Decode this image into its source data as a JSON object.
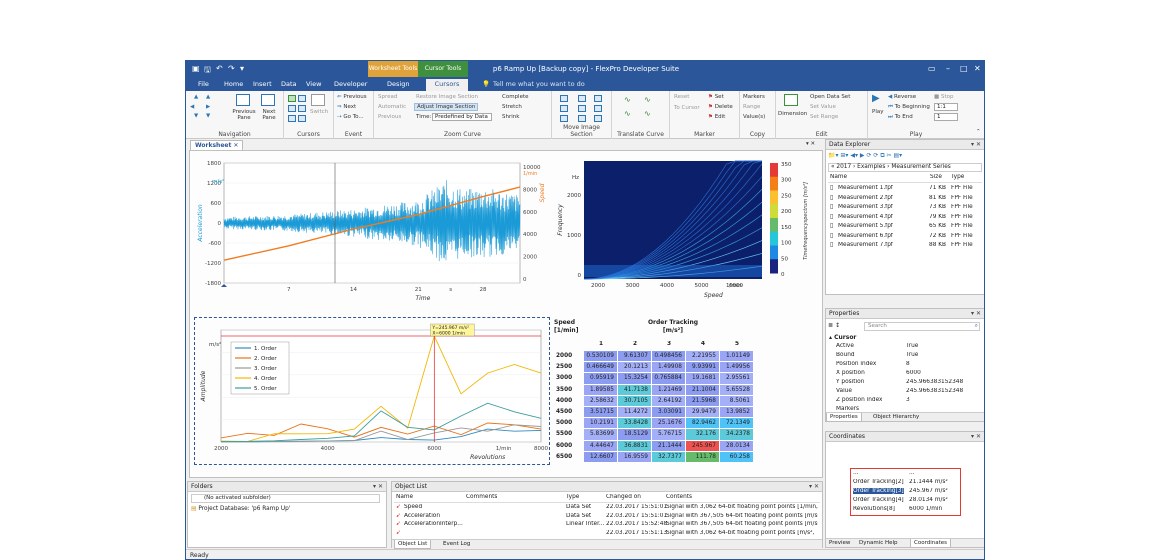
{
  "title": "p6 Ramp Up [Backup copy] - FlexPro Developer Suite",
  "context_tabs": {
    "worksheet_tools": "Worksheet Tools",
    "cursor_tools": "Cursor Tools"
  },
  "menu": [
    {
      "label": "File",
      "active": false
    },
    {
      "label": "Home",
      "active": false
    },
    {
      "label": "Insert",
      "active": false
    },
    {
      "label": "Data",
      "active": false
    },
    {
      "label": "View",
      "active": false
    },
    {
      "label": "Developer",
      "active": false
    },
    {
      "label": "Design",
      "active": false
    },
    {
      "label": "Cursors",
      "active": true
    }
  ],
  "tell_me": "Tell me what you want to do",
  "ribbon": {
    "navigation": {
      "label": "Navigation",
      "prev_pane": "Previous Pane",
      "next_pane": "Next Pane"
    },
    "cursors": {
      "label": "Cursors",
      "switch": "Switch"
    },
    "event": {
      "label": "Event",
      "previous": "Previous",
      "next": "Next",
      "goto": "Go To..."
    },
    "zoom": {
      "label": "Zoom Curve",
      "spread": "Spread",
      "automatic": "Automatic",
      "previous": "Previous",
      "restore": "Restore Image Section",
      "adjust": "Adjust Image Section",
      "time_label": "Time:",
      "time_value": "Predefined by Data",
      "complete": "Complete",
      "stretch": "Stretch",
      "shrink": "Shrink"
    },
    "move": {
      "label": "Move Image Section"
    },
    "translate": {
      "label": "Translate Curve"
    },
    "marker": {
      "label": "Marker",
      "reset": "Reset",
      "to_cursor": "To Cursor",
      "set": "Set",
      "delete": "Delete",
      "edit": "Edit"
    },
    "copy": {
      "label": "Copy",
      "markers": "Markers",
      "range": "Range",
      "values": "Value(s)"
    },
    "edit": {
      "label": "Edit",
      "dimension": "Dimension",
      "open_data_set": "Open Data Set",
      "set_value": "Set Value",
      "set_range": "Set Range"
    },
    "play": {
      "label": "Play",
      "play": "Play",
      "reverse": "Reverse",
      "to_beginning": "To Beginning",
      "to_end": "To End",
      "stop": "Stop",
      "ratio": "1:1",
      "step": "1"
    }
  },
  "doc_tab": "Worksheet",
  "chart_data": [
    {
      "type": "line",
      "x_ticks": [
        "7",
        "14",
        "21",
        "28"
      ],
      "xlabel": "Time",
      "x_unit": "s",
      "y_left_label": "Acceleration",
      "y_left_unit": "m/s²",
      "y_left_ticks": [
        "1800",
        "1200",
        "600",
        "0",
        "-600",
        "-1200",
        "-1800"
      ],
      "y_right_label": "Speed",
      "y_right_unit": "1/min",
      "y_right_ticks": [
        "10000",
        "8000",
        "6000",
        "4000",
        "2000",
        "0"
      ],
      "series": [
        {
          "name": "Acceleration",
          "color": "#1a9ad6",
          "envelope_x": [
            0,
            7,
            14,
            21,
            24,
            26,
            28,
            32
          ],
          "envelope_y": [
            180,
            250,
            420,
            700,
            1300,
            1000,
            1100,
            850
          ]
        },
        {
          "name": "Speed",
          "color": "#f07c22",
          "x": [
            0,
            7,
            14,
            21,
            28,
            32
          ],
          "y": [
            1900,
            3100,
            4500,
            5700,
            7200,
            8000
          ]
        }
      ],
      "cursor_x": 12
    },
    {
      "type": "heatmap",
      "x_ticks": [
        "2000",
        "3000",
        "4000",
        "5000",
        "6000"
      ],
      "x_unit": "1/min",
      "xlabel": "Speed",
      "y_ticks": [
        "2000",
        "1000",
        "0"
      ],
      "y_unit": "Hz",
      "ylabel": "Frequency",
      "colorbar_ticks": [
        "350",
        "300",
        "250",
        "200",
        "150",
        "100",
        "50",
        "0"
      ],
      "colorbar_label": "Timefrequencyspectrum [m/s²]"
    },
    {
      "type": "line",
      "xlabel": "Revolutions",
      "x_unit": "1/min",
      "ylabel": "Amplitude",
      "y_unit": "m/s²",
      "x_ticks": [
        "2000",
        "4000",
        "6000",
        "8000"
      ],
      "x": [
        2000,
        2500,
        3000,
        3500,
        4000,
        4500,
        5000,
        5500,
        6000,
        6500,
        7000,
        7500,
        8000
      ],
      "series": [
        {
          "name": "1. Order",
          "color": "#2e8bc0",
          "values": [
            0.5,
            0.4,
            0.9,
            1.9,
            2.6,
            3.5,
            10.2,
            5.8,
            4.4,
            12.6,
            30,
            25,
            27
          ]
        },
        {
          "name": "2. Order",
          "color": "#e8731a",
          "values": [
            9.6,
            20.1,
            15.3,
            41.7,
            30.7,
            11.4,
            33.8,
            18.5,
            36.8,
            16.9,
            44,
            40,
            30
          ]
        },
        {
          "name": "3. Order",
          "color": "#999999",
          "values": [
            0.5,
            1.5,
            0.8,
            1.2,
            2.6,
            3.0,
            25.2,
            5.8,
            21.1,
            32.7,
            25,
            40,
            36
          ]
        },
        {
          "name": "4. Order",
          "color": "#f2b705",
          "values": [
            2.2,
            1.5,
            19.2,
            19.0,
            19.2,
            29.9,
            82.9,
            32.2,
            246,
            111.8,
            160,
            180,
            160
          ]
        },
        {
          "name": "5. Order",
          "color": "#3a9e9e",
          "values": [
            1.0,
            1.5,
            2.9,
            5.7,
            8.5,
            14.0,
            72.1,
            34.2,
            28.0,
            60.3,
            90,
            70,
            55
          ]
        }
      ],
      "cursor_x": 6000,
      "tooltip": [
        "Y=245.967 m/s²",
        "X=6000 1/min"
      ]
    }
  ],
  "order_table": {
    "title": "Order Tracking",
    "unit": "[m/s²]",
    "row_header": "Speed",
    "row_unit": "[1/min]",
    "columns": [
      "1",
      "2",
      "3",
      "4",
      "5"
    ],
    "rows": [
      {
        "speed": "2000",
        "values": [
          "0.530109",
          "9.61307",
          "0.498456",
          "2.21955",
          "1.01149"
        ]
      },
      {
        "speed": "2500",
        "values": [
          "0.466649",
          "20.1213",
          "1.49908",
          "9.93991",
          "1.49956"
        ]
      },
      {
        "speed": "3000",
        "values": [
          "0.95919",
          "15.3254",
          "0.765884",
          "19.1681",
          "2.95561"
        ]
      },
      {
        "speed": "3500",
        "values": [
          "1.89585",
          "41.7138",
          "1.21469",
          "21.1004",
          "5.65528"
        ]
      },
      {
        "speed": "4000",
        "values": [
          "2.58632",
          "30.7105",
          "2.64192",
          "21.5968",
          "8.5061"
        ]
      },
      {
        "speed": "4500",
        "values": [
          "3.51715",
          "11.4272",
          "3.03091",
          "29.9479",
          "13.9852"
        ]
      },
      {
        "speed": "5000",
        "values": [
          "10.2191",
          "33.8428",
          "25.1676",
          "82.9462",
          "72.1349"
        ]
      },
      {
        "speed": "5500",
        "values": [
          "5.83699",
          "18.5129",
          "5.76715",
          "32.176",
          "34.2378"
        ]
      },
      {
        "speed": "6000",
        "values": [
          "4.44647",
          "36.8831",
          "21.1444",
          "245.967",
          "28.0134"
        ]
      },
      {
        "speed": "6500",
        "values": [
          "12.6607",
          "16.9559",
          "32.7377",
          "111.78",
          "60.258"
        ]
      }
    ]
  },
  "data_explorer": {
    "title": "Data Explorer",
    "path": [
      "«",
      "2017",
      "Examples",
      "Measurement Series"
    ],
    "columns": [
      "Name",
      "Size",
      "Type"
    ],
    "files": [
      {
        "name": "Measurement 1.fpf",
        "size": "71 KB",
        "type": "FPF File"
      },
      {
        "name": "Measurement 2.fpf",
        "size": "81 KB",
        "type": "FPF File"
      },
      {
        "name": "Measurement 3.fpf",
        "size": "73 KB",
        "type": "FPF File"
      },
      {
        "name": "Measurement 4.fpf",
        "size": "79 KB",
        "type": "FPF File"
      },
      {
        "name": "Measurement 5.fpf",
        "size": "65 KB",
        "type": "FPF File"
      },
      {
        "name": "Measurement 6.fpf",
        "size": "72 KB",
        "type": "FPF File"
      },
      {
        "name": "Measurement 7.fpf",
        "size": "88 KB",
        "type": "FPF File"
      }
    ]
  },
  "properties": {
    "title": "Properties",
    "search_placeholder": "Search",
    "group": "Cursor",
    "items": [
      {
        "k": "Active",
        "v": "True"
      },
      {
        "k": "Bound",
        "v": "True"
      },
      {
        "k": "Position index",
        "v": "8"
      },
      {
        "k": "X position",
        "v": "6000"
      },
      {
        "k": "Y position",
        "v": "245.966383152348"
      },
      {
        "k": "Value",
        "v": "245.966383152348"
      },
      {
        "k": "Z position index",
        "v": "3"
      },
      {
        "k": "Markers",
        "v": ""
      }
    ],
    "tabs": [
      "Properties",
      "Object Hierarchy"
    ]
  },
  "coordinates": {
    "title": "Coordinates",
    "rows": [
      {
        "k": "...",
        "v": "..."
      },
      {
        "k": "Order Tracking[2]",
        "v": "21.1444 m/s²"
      },
      {
        "k": "Order Tracking[3]",
        "v": "245.967 m/s²"
      },
      {
        "k": "Order Tracking[4]",
        "v": "28.0134 m/s²"
      },
      {
        "k": "Revolutions[8]",
        "v": "6000 1/min"
      }
    ],
    "tabs": [
      "Preview",
      "Dynamic Help",
      "Coordinates"
    ]
  },
  "folders": {
    "title": "Folders",
    "subfolder": "(No activated subfolder)",
    "project": "Project Database: 'p6 Ramp Up'"
  },
  "object_list": {
    "title": "Object List",
    "columns": [
      "Name",
      "Comments",
      "Type",
      "Changed on",
      "Contents"
    ],
    "rows": [
      {
        "name": "Speed",
        "comments": "",
        "type": "Data Set",
        "changed": "22.03.2017 15:51:01",
        "contents": "Signal with 3,062 64-bit floating point points [1/min,"
      },
      {
        "name": "Acceleration",
        "comments": "",
        "type": "Data Set",
        "changed": "22.03.2017 15:51:01",
        "contents": "Signal with 367,505 64-bit floating point points [m/s²,"
      },
      {
        "name": "AccelerationInterp...",
        "comments": "",
        "type": "Linear Inter...",
        "changed": "22.03.2017 15:52:48",
        "contents": "Signal with 367,505 64-bit floating point points [m/s²,"
      },
      {
        "name": "",
        "comments": "",
        "type": "",
        "changed": "22.03.2017 15:51:13",
        "contents": "Signal with 3,062 64-bit floating point points [m/s²,"
      }
    ],
    "tabs": [
      "Object List",
      "Event Log"
    ]
  },
  "status": "Ready",
  "colors": {
    "accent": "#2b579a",
    "acceleration": "#1a9ad6",
    "speed": "#f07c22",
    "highlight": "#e53935"
  }
}
